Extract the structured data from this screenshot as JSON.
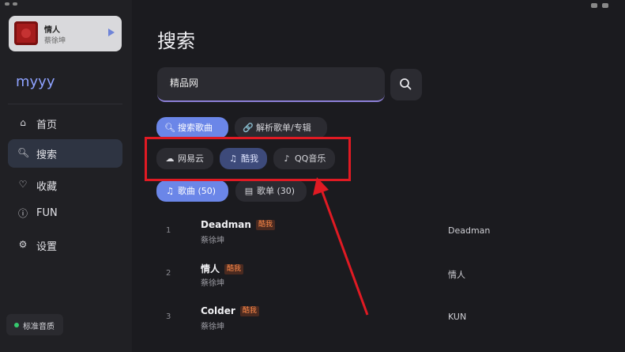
{
  "now_playing": {
    "title": "情人",
    "artist": "蔡徐坤"
  },
  "sidebar": {
    "brand": "myyy",
    "items": [
      {
        "label": "首页",
        "icon": "home-icon",
        "glyph": "⌂"
      },
      {
        "label": "搜索",
        "icon": "search-icon",
        "glyph": "🔍︎"
      },
      {
        "label": "收藏",
        "icon": "heart-icon",
        "glyph": "♡"
      },
      {
        "label": "FUN",
        "icon": "info-icon",
        "glyph": "ⓘ"
      },
      {
        "label": "设置",
        "icon": "gear-icon",
        "glyph": "⚙"
      }
    ],
    "active_index": 1,
    "quality_label": "标准音质"
  },
  "main": {
    "title": "搜索",
    "search_value": "精品网",
    "mode_tabs": [
      {
        "label": "搜索歌曲",
        "glyph": "🔍︎"
      },
      {
        "label": "解析歌单/专辑",
        "glyph": "🔗"
      }
    ],
    "sources": [
      {
        "label": "网易云",
        "glyph": "☁"
      },
      {
        "label": "酷我",
        "glyph": "♫"
      },
      {
        "label": "QQ音乐",
        "glyph": "♪"
      }
    ],
    "result_tabs": [
      {
        "label": "歌曲 (50)",
        "glyph": "♫"
      },
      {
        "label": "歌单 (30)",
        "glyph": "▤"
      }
    ],
    "results": [
      {
        "index": "1",
        "title": "Deadman",
        "tag": "酷我",
        "artist": "蔡徐坤",
        "album": "Deadman"
      },
      {
        "index": "2",
        "title": "情人",
        "tag": "酷我",
        "artist": "蔡徐坤",
        "album": "情人"
      },
      {
        "index": "3",
        "title": "Colder",
        "tag": "酷我",
        "artist": "蔡徐坤",
        "album": "KUN"
      }
    ]
  },
  "colors": {
    "accent": "#6b86e8",
    "highlight": "#e01a23",
    "tag": "#ff8a4a"
  }
}
